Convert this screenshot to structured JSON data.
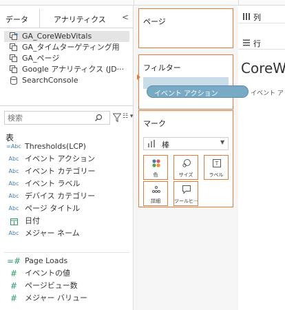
{
  "tabs": {
    "data_label": "データ",
    "analytics_label": "アナリティクス",
    "collapse_glyph": "<"
  },
  "data_sources": [
    {
      "label": "GA_CoreWebVitals",
      "icon": "database-icon",
      "selected": true
    },
    {
      "label": "GA_タイムターゲティング用",
      "icon": "database-icon",
      "selected": false
    },
    {
      "label": "GA_ページ",
      "icon": "database-icon",
      "selected": false
    },
    {
      "label": "Google アナリティクス (JD···",
      "icon": "database-icon",
      "selected": false
    },
    {
      "label": "SearchConsole",
      "icon": "cylinder-icon",
      "selected": false
    }
  ],
  "search": {
    "placeholder": "検索"
  },
  "list_view_glyph": "☷ ▾",
  "fields_section": {
    "title": "表",
    "dimensions": [
      {
        "type": "=Abc",
        "label": "Thresholds(LCP)"
      },
      {
        "type": "Abc",
        "label": "イベント アクション"
      },
      {
        "type": "Abc",
        "label": "イベント カテゴリー"
      },
      {
        "type": "Abc",
        "label": "イベント ラベル"
      },
      {
        "type": "Abc",
        "label": "デバイス カテゴリー"
      },
      {
        "type": "Abc",
        "label": "ページ タイトル"
      },
      {
        "type": "date-icon",
        "label": "日付"
      },
      {
        "type": "Abc",
        "label": "メジャー ネーム"
      }
    ],
    "measures": [
      {
        "type": "=#",
        "label": "Page Loads"
      },
      {
        "type": "#",
        "label": "イベントの値"
      },
      {
        "type": "#",
        "label": "ページビュー数"
      },
      {
        "type": "#",
        "label": "メジャー バリュー"
      }
    ]
  },
  "shelves": {
    "pages_title": "ページ",
    "filters_title": "フィルター",
    "marks_title": "マーク",
    "columns_label": "列",
    "rows_label": "行"
  },
  "marks": {
    "mark_type": "棒",
    "buttons": [
      {
        "label": "色",
        "icon": "color-dots-icon"
      },
      {
        "label": "サイズ",
        "icon": "size-icon"
      },
      {
        "label": "ラベル",
        "icon": "label-icon"
      },
      {
        "label": "詳細",
        "icon": "detail-icon"
      },
      {
        "label": "ツールヒ···",
        "icon": "tooltip-icon"
      }
    ]
  },
  "drag_pill_label": "イベント アクション",
  "viz": {
    "title": "CoreW",
    "subtitle": "イベント ア"
  },
  "colors": {
    "accent_orange": "#e07b39",
    "pill_blue": "#78aac5",
    "dimension_blue": "#3f7fb3",
    "measure_green": "#2e9e6a"
  }
}
